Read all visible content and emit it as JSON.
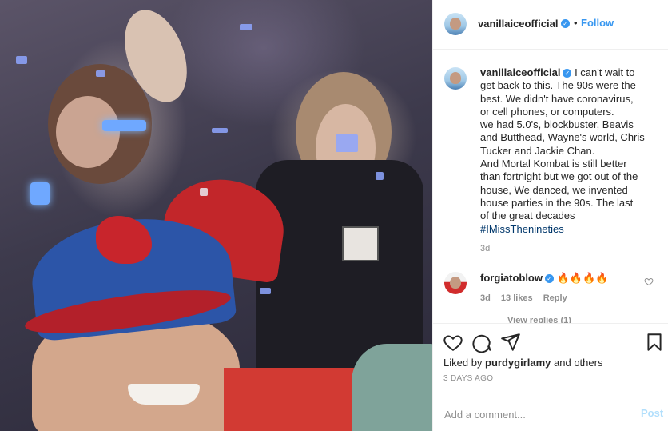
{
  "post": {
    "username": "vanillaiceofficial",
    "verified_mark": "✓",
    "dot": "•",
    "follow_label": "Follow"
  },
  "caption": {
    "username": "vanillaiceofficial",
    "lines": [
      "I can't wait to",
      "get back to this. The 90s were the",
      "best. We didn't have coronavirus,",
      "or cell phones, or computers.",
      "we had 5.0's, blockbuster, Beavis",
      "and Butthead, Wayne's world, Chris",
      "Tucker and Jackie Chan.",
      "And Mortal Kombat is still better",
      "than fortnight but we got out of the",
      "house, We danced, we invented",
      "house parties in the 90s. The last",
      "of the great decades"
    ],
    "hashtag": "#IMissThenineties",
    "time": "3d"
  },
  "comment": {
    "username": "forgiatoblow",
    "text": "🔥🔥🔥🔥",
    "time": "3d",
    "likes": "13 likes",
    "reply": "Reply",
    "view_replies": "View replies (1)"
  },
  "actions": {
    "icons": [
      "heart-icon",
      "comment-icon",
      "share-icon",
      "bookmark-icon"
    ],
    "liked_by_prefix": "Liked by ",
    "liked_by_user": "purdygirlamy",
    "liked_by_suffix": " and others",
    "date": "3 DAYS AGO"
  },
  "add_comment": {
    "placeholder": "Add a comment...",
    "post_label": "Post"
  },
  "colors": {
    "link": "#3897f0",
    "hashtag": "#00376b",
    "muted": "#8e8e8e",
    "post_disabled": "#b2dffc"
  }
}
